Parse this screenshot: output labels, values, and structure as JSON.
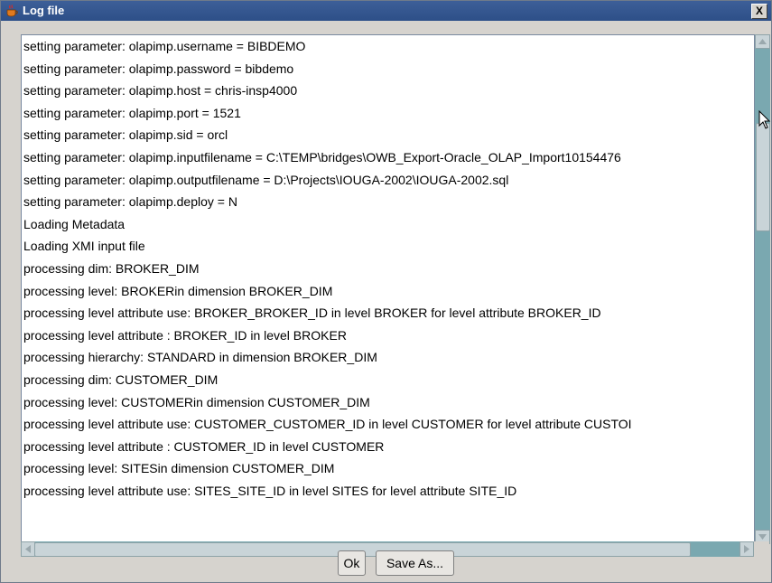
{
  "window": {
    "title": "Log file",
    "close_glyph": "X"
  },
  "log_lines": [
    "setting parameter: olapimp.username = BIBDEMO",
    "setting parameter: olapimp.password = bibdemo",
    "setting parameter: olapimp.host = chris-insp4000",
    "setting parameter: olapimp.port = 1521",
    "setting parameter: olapimp.sid = orcl",
    "setting parameter: olapimp.inputfilename = C:\\TEMP\\bridges\\OWB_Export-Oracle_OLAP_Import10154476",
    "setting parameter: olapimp.outputfilename = D:\\Projects\\IOUGA-2002\\IOUGA-2002.sql",
    "setting parameter: olapimp.deploy = N",
    "Loading Metadata",
    "Loading XMI input file",
    "processing dim: BROKER_DIM",
    "processing level: BROKERin dimension BROKER_DIM",
    "processing level attribute use: BROKER_BROKER_ID in level BROKER for level attribute BROKER_ID",
    "processing level attribute : BROKER_ID in level BROKER",
    "processing hierarchy: STANDARD in dimension BROKER_DIM",
    "processing dim: CUSTOMER_DIM",
    "processing level: CUSTOMERin dimension CUSTOMER_DIM",
    "processing level attribute use: CUSTOMER_CUSTOMER_ID in level CUSTOMER for level attribute CUSTOI",
    "processing level attribute : CUSTOMER_ID in level CUSTOMER",
    "processing level: SITESin dimension CUSTOMER_DIM",
    "processing level attribute use: SITES_SITE_ID in level SITES for level attribute SITE_ID"
  ],
  "buttons": {
    "ok": "Ok",
    "save_as": "Save As..."
  },
  "icons": {
    "title": "java-cup-icon",
    "scroll_up": "scroll-up-arrow-icon",
    "scroll_down": "scroll-down-arrow-icon",
    "scroll_left": "scroll-left-arrow-icon",
    "scroll_right": "scroll-right-arrow-icon",
    "cursor": "mouse-pointer-icon"
  }
}
